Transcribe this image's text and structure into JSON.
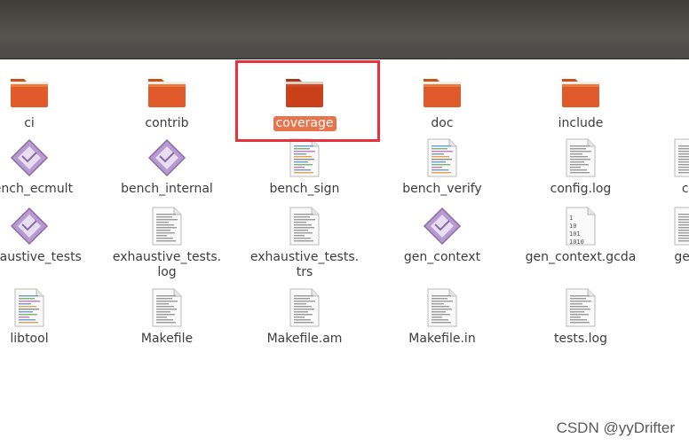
{
  "window": {
    "title": ""
  },
  "files": [
    {
      "name": "ci",
      "type": "folder",
      "selected": false
    },
    {
      "name": "contrib",
      "type": "folder",
      "selected": false
    },
    {
      "name": "coverage",
      "type": "folder",
      "selected": true
    },
    {
      "name": "doc",
      "type": "folder",
      "selected": false
    },
    {
      "name": "include",
      "type": "folder",
      "selected": false
    },
    {
      "name": "bench_ecmult",
      "type": "executable",
      "selected": false
    },
    {
      "name": "bench_internal",
      "type": "executable",
      "selected": false
    },
    {
      "name": "bench_sign",
      "type": "script",
      "selected": false
    },
    {
      "name": "bench_verify",
      "type": "script",
      "selected": false
    },
    {
      "name": "config.log",
      "type": "text",
      "selected": false
    },
    {
      "name": "co",
      "type": "text",
      "selected": false
    },
    {
      "name": "exhaustive_tests",
      "type": "executable",
      "selected": false
    },
    {
      "name": "exhaustive_tests.\nlog",
      "type": "text",
      "selected": false
    },
    {
      "name": "exhaustive_tests.\ntrs",
      "type": "text",
      "selected": false
    },
    {
      "name": "gen_context",
      "type": "executable",
      "selected": false
    },
    {
      "name": "gen_context.gcda",
      "type": "binary",
      "selected": false
    },
    {
      "name": "gen_",
      "type": "text",
      "selected": false
    },
    {
      "name": "libtool",
      "type": "script",
      "selected": false
    },
    {
      "name": "Makefile",
      "type": "text",
      "selected": false
    },
    {
      "name": "Makefile.am",
      "type": "text",
      "selected": false
    },
    {
      "name": "Makefile.in",
      "type": "text",
      "selected": false
    },
    {
      "name": "tests.log",
      "type": "text",
      "selected": false
    }
  ],
  "watermark": "CSDN @yyDrifter",
  "colors": {
    "folder": "#e05a2b",
    "folder_selected": "#c9401a",
    "selection_label": "#e9734a",
    "annotation_box": "#e8313a",
    "executable": "#8b6aa8"
  }
}
